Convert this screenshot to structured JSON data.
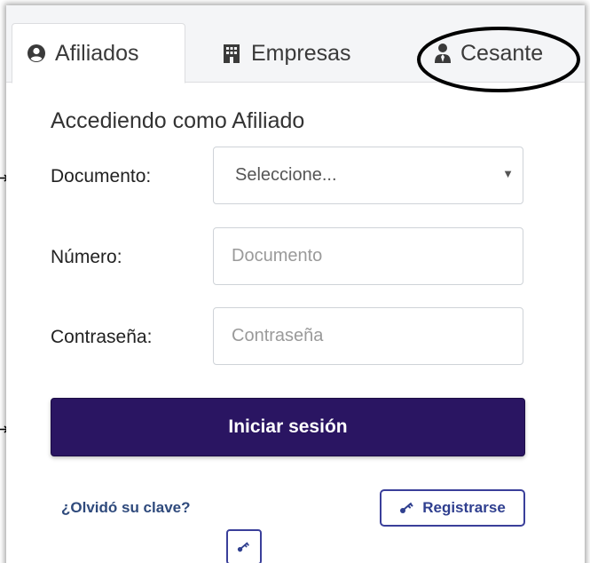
{
  "tabs": [
    {
      "label": "Afiliados",
      "icon": "user-circle-icon",
      "active": true
    },
    {
      "label": "Empresas",
      "icon": "building-icon",
      "active": false
    },
    {
      "label": "Cesante",
      "icon": "user-tie-icon",
      "active": false
    }
  ],
  "form": {
    "title": "Accediendo como Afiliado",
    "documento": {
      "label": "Documento:",
      "selected": "Seleccione..."
    },
    "numero": {
      "label": "Número:",
      "placeholder": "Documento"
    },
    "contrasena": {
      "label": "Contraseña:",
      "placeholder": "Contraseña"
    },
    "login_label": "Iniciar sesión"
  },
  "links": {
    "forgot": "¿Olvidó su clave?",
    "register": "Registrarse"
  },
  "colors": {
    "primary": "#2a1562",
    "link": "#2f4a7c",
    "outline": "#3a3f9a",
    "tab_bg": "#f4f5f7"
  }
}
